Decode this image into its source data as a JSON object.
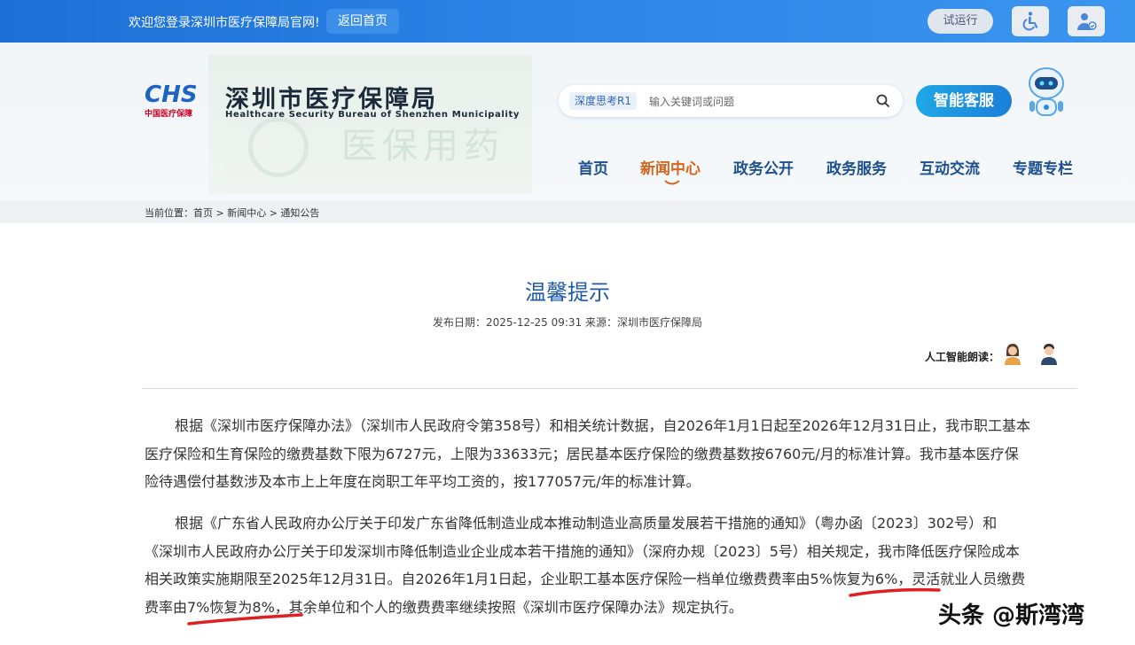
{
  "topbar": {
    "welcome": "欢迎您登录深圳市医疗保障局官网!",
    "home": "返回首页",
    "trial": "试运行",
    "icons": [
      "accessibility-icon",
      "elder-mode-icon"
    ]
  },
  "header": {
    "logo_text": "CHS",
    "logo_sub": "中国医疗保障",
    "org_name_cn": "深圳市医疗保障局",
    "org_name_en": "Healthcare Security Bureau of Shenzhen Municipality",
    "banner_text": "医保用药",
    "search": {
      "tag": "深度思考R1",
      "placeholder": "输入关键词或问题"
    },
    "smart_service": "智能客服",
    "nav": [
      "首页",
      "新闻中心",
      "政务公开",
      "政务服务",
      "互动交流",
      "专题专栏"
    ],
    "nav_active": "新闻中心"
  },
  "breadcrumb": "当前位置：首页 > 新闻中心 > 通知公告",
  "article": {
    "title": "温馨提示",
    "meta": "发布日期：2025-12-25 09:31 来源：深圳市医疗保障局",
    "ai_reader_label": "人工智能朗读：",
    "p1": [
      "根据《深圳市医疗保障办法》（深圳市人民政府令第358号）和相关统计数据，自2026年1月1日起至2026年12月31日止，我市职工基本",
      "医疗保险和生育保险的缴费基数下限为6727元，上限为33633元；居民基本医疗保险的缴费基数按6760元/月的标准计算。我市基本医疗保",
      "险待遇偿付基数涉及本市上上年度在岗职工年平均工资的，按177057元/年的标准计算。"
    ],
    "p2": [
      "根据《广东省人民政府办公厅关于印发广东省降低制造业成本推动制造业高质量发展若干措施的通知》（粤办函〔2023〕302号）和",
      "《深圳市人民政府办公厅关于印发深圳市降低制造业企业成本若干措施的通知》（深府办规〔2023〕5号）相关规定，我市降低医疗保险成本",
      "相关政策实施期限至2025年12月31日。自2026年1月1日起，企业职工基本医疗保险一档单位缴费费率由5%恢复为6%，灵活就业人员缴费",
      "费率由7%恢复为8%，其余单位和个人的缴费费率继续按照《深圳市医疗保障办法》规定执行。"
    ]
  },
  "watermark": "头条 @斯湾湾",
  "colors": {
    "topbar": "#1c6fd6",
    "title": "#1f5aa8",
    "nav": "#1e4f8f",
    "nav_active": "#d4661e",
    "annotation": "#e02020"
  }
}
